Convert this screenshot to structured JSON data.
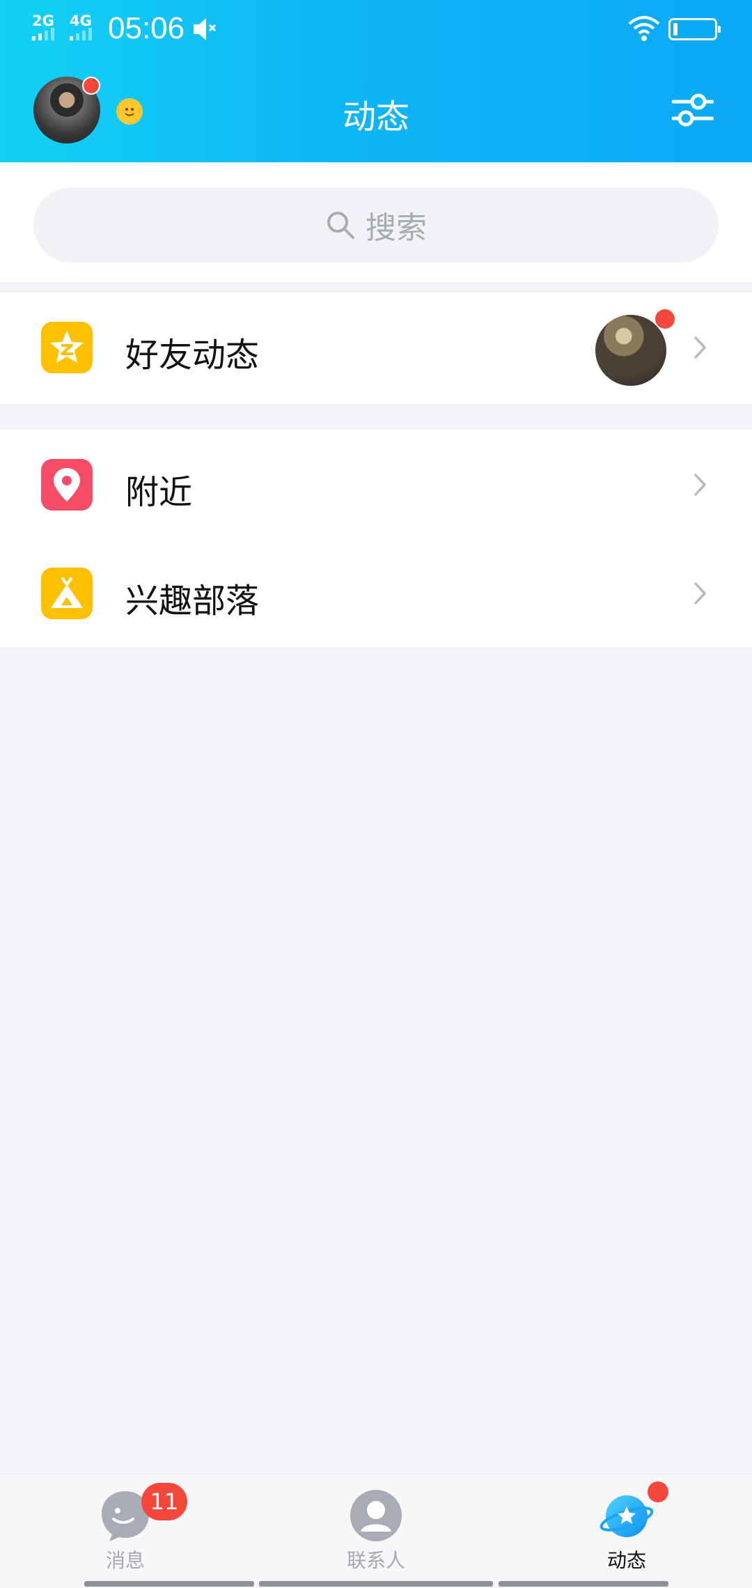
{
  "status_bar": {
    "sim1": "2G",
    "sim2": "4G",
    "time": "05:06",
    "icons": [
      "speaker-mute-icon",
      "wifi-icon",
      "battery-icon"
    ],
    "battery_percent": 10
  },
  "header": {
    "title": "动态",
    "icons": [
      "avatar",
      "mood-icon",
      "settings-sliders-icon"
    ]
  },
  "search": {
    "placeholder": "搜索",
    "icon": "search-icon"
  },
  "items": [
    {
      "label": "好友动态",
      "icon": "qzone-star-icon",
      "icon_color": "#ffc000",
      "has_thumbnail": true,
      "has_dot": true
    },
    {
      "label": "附近",
      "icon": "location-pin-icon",
      "icon_color": "#f64c67"
    },
    {
      "label": "兴趣部落",
      "icon": "tent-icon",
      "icon_color": "#ffc000"
    }
  ],
  "tabbar": {
    "tabs": [
      {
        "label": "消息",
        "icon": "chat-bubble-icon",
        "badge": "11",
        "active": false
      },
      {
        "label": "联系人",
        "icon": "contacts-person-icon",
        "active": false
      },
      {
        "label": "动态",
        "icon": "planet-star-icon",
        "active": true,
        "dot": true
      }
    ]
  },
  "colors": {
    "header_gradient_start": "#13d1f3",
    "header_gradient_end": "#0aa8f5",
    "badge_red": "#f4493a",
    "page_bg": "#f3f4f8"
  }
}
